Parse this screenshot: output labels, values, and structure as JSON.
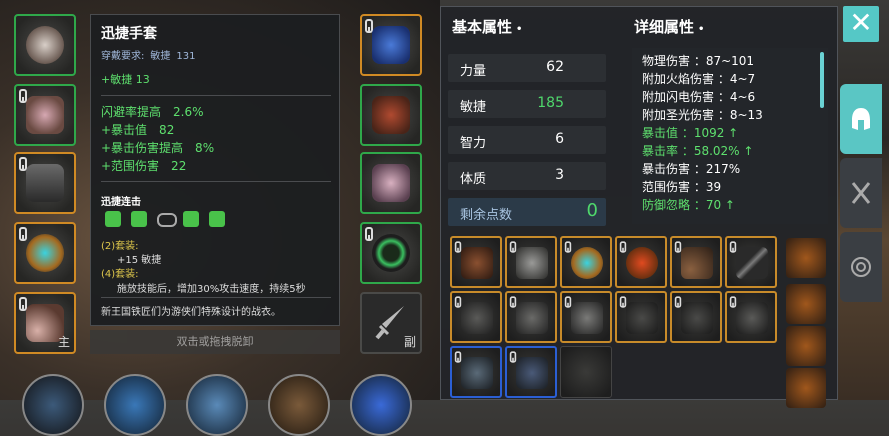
{
  "tooltip": {
    "title": "迅捷手套",
    "req_label": "穿戴要求:",
    "req_stat": "敏捷",
    "req_value": "131",
    "primary": "+敏捷 13",
    "bonuses": [
      "闪避率提高　2.6%",
      "+暴击值　82",
      "+暴击伤害提高　8%",
      "+范围伤害　22"
    ],
    "set_name": "迅捷连击",
    "set2_label": "(2)套装:",
    "set2_effect": "+15 敏捷",
    "set4_label": "(4)套装:",
    "set4_effect": "施放技能后，增加30%攻击速度，持续5秒",
    "description": "新王国铁匠们为游侠们特殊设计的战衣。",
    "hint": "双击或拖拽脱卸"
  },
  "slots": {
    "weapon_main_tag": "主",
    "weapon_off_tag": "副"
  },
  "stats_panel": {
    "base_title": "基本属性",
    "detail_title": "详细属性",
    "base": [
      {
        "name": "力量",
        "value": "62"
      },
      {
        "name": "敏捷",
        "value": "185"
      },
      {
        "name": "智力",
        "value": "6"
      },
      {
        "name": "体质",
        "value": "3"
      }
    ],
    "remaining_label": "剩余点数",
    "remaining_value": "0",
    "details": [
      "物理伤害 ：87~101",
      "附加火焰伤害 ：4~7",
      "附加闪电伤害 ：4~6",
      "附加圣光伤害 ：8~13",
      "暴击值 ：1092 ↑",
      "暴击率 ：58.02% ↑",
      "暴击伤害 ：217%",
      "范围伤害 ：39",
      "防御忽略 ：70 ↑"
    ]
  },
  "colors": {
    "green": "#5ee06e",
    "teal": "#5ac6c4",
    "orange_frame": "#d08a24",
    "green_frame": "#2fa84a"
  },
  "icons": {
    "close": "close-icon",
    "tab_equipment": "helmet-icon",
    "tab_skills": "crossed-swords-icon",
    "tab_settings": "target-icon"
  }
}
